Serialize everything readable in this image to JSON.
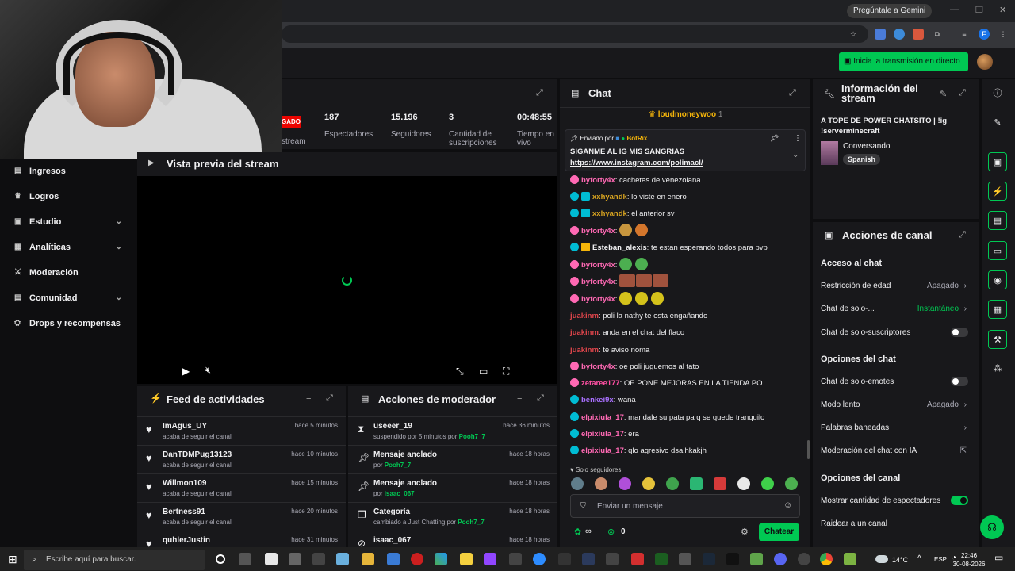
{
  "browser": {
    "gemini": "Pregúntale a Gemini"
  },
  "topnav": {
    "go_live": "Inicia la transmisión en directo"
  },
  "sidebar": {
    "items": [
      {
        "label": "Ingresos",
        "icon": "money-icon"
      },
      {
        "label": "Logros",
        "icon": "trophy-icon"
      },
      {
        "label": "Estudio",
        "icon": "studio-icon"
      },
      {
        "label": "Analíticas",
        "icon": "analytics-icon"
      },
      {
        "label": "Moderación",
        "icon": "sword-icon"
      },
      {
        "label": "Comunidad",
        "icon": "community-icon"
      },
      {
        "label": "Drops y recompensas",
        "icon": "gift-icon"
      }
    ]
  },
  "stats": {
    "live": "GADO",
    "stream_label": "stream",
    "viewers": "187",
    "viewers_label": "Espectadores",
    "followers": "15.196",
    "followers_label": "Seguidores",
    "subs": "3",
    "subs_label": "Cantidad de suscripciones",
    "time": "00:48:55",
    "time_label": "Tiempo en vivo"
  },
  "preview": {
    "title": "Vista previa del stream"
  },
  "feed": {
    "title": "Feed de actividades",
    "items": [
      {
        "name": "ImAgus_UY",
        "desc": "acaba de seguir el canal",
        "time": "hace 5 minutos"
      },
      {
        "name": "DanTDMPug13123",
        "desc": "acaba de seguir el canal",
        "time": "hace 10 minutos"
      },
      {
        "name": "Willmon109",
        "desc": "acaba de seguir el canal",
        "time": "hace 15 minutos"
      },
      {
        "name": "Bertness91",
        "desc": "acaba de seguir el canal",
        "time": "hace 20 minutos"
      },
      {
        "name": "quhlerJustin",
        "desc": "",
        "time": "hace 31 minutos"
      }
    ]
  },
  "modactions": {
    "title": "Acciones de moderador",
    "items": [
      {
        "name": "useeer_19",
        "desc": "suspendido por 5 minutos por",
        "who": "Pooh7_7",
        "time": "hace 36 minutos"
      },
      {
        "name": "Mensaje anclado",
        "desc": "por",
        "who": "Pooh7_7",
        "time": "hace 18 horas"
      },
      {
        "name": "Mensaje anclado",
        "desc": "por",
        "who": "isaac_067",
        "time": "hace 18 horas"
      },
      {
        "name": "Categoría",
        "desc": "cambiado a Just Chatting por",
        "who": "Pooh7_7",
        "time": "hace 18 horas"
      },
      {
        "name": "isaac_067",
        "desc": "",
        "who": "",
        "time": "hace 18 horas"
      }
    ]
  },
  "chat": {
    "title": "Chat",
    "top_user": "loudmoneywoo",
    "top_count": "1",
    "pinned": {
      "sent_by": "Enviado por",
      "bot": "BotRix",
      "text": "SIGANME AL IG MIS SANGRIAS",
      "link": "https://www.instagram.com/polimacl/"
    },
    "messages": [
      {
        "user": "byforty4x",
        "color": "#ff69b4",
        "text": "cachetes de venezolana"
      },
      {
        "user": "xxhyandk",
        "color": "#daa520",
        "text": "lo viste en enero"
      },
      {
        "user": "xxhyandk",
        "color": "#daa520",
        "text": "el anterior sv"
      },
      {
        "user": "byforty4x",
        "color": "#ff69b4",
        "text": ""
      },
      {
        "user": "Esteban_alexis",
        "color": "#efeff1",
        "text": "te estan esperando todos para pvp"
      },
      {
        "user": "byforty4x",
        "color": "#ff69b4",
        "text": ""
      },
      {
        "user": "byforty4x",
        "color": "#ff69b4",
        "text": ""
      },
      {
        "user": "byforty4x",
        "color": "#ff69b4",
        "text": ""
      },
      {
        "user": "juakinm",
        "color": "#e0454b",
        "text": "poli la nathy te esta engañando"
      },
      {
        "user": "juakinm",
        "color": "#e0454b",
        "text": "anda en el chat del flaco"
      },
      {
        "user": "juakinm",
        "color": "#e0454b",
        "text": "te aviso noma"
      },
      {
        "user": "byforty4x",
        "color": "#ff69b4",
        "text": "oe poli juguemos al tato"
      },
      {
        "user": "zetaree177",
        "color": "#ff4fa3",
        "text": "OE PONE MEJORAS EN LA TIENDA PO"
      },
      {
        "user": "benkei9x",
        "color": "#a970ff",
        "text": "wana"
      },
      {
        "user": "elpixiula_17",
        "color": "#ff69b4",
        "text": "mandale su pata pa q se quede tranquilo"
      },
      {
        "user": "elpixiula_17",
        "color": "#ff69b4",
        "text": "era"
      },
      {
        "user": "elpixiula_17",
        "color": "#ff69b4",
        "text": "qlo agresivo dsajhkakjh"
      }
    ],
    "followers_only": "Solo seguidores",
    "placeholder": "Enviar un mensaje",
    "points": "∞",
    "points2": "0",
    "send": "Chatear"
  },
  "info": {
    "title": "Información del stream",
    "stream_title": "A TOPE DE POWER CHATSITO | !ig !serverminecraft",
    "category": "Conversando",
    "tag": "Spanish"
  },
  "actions": {
    "title": "Acciones de canal",
    "chat_access": "Acceso al chat",
    "age": "Restricción de edad",
    "age_val": "Apagado",
    "solo": "Chat de solo-...",
    "solo_val": "Instantáneo",
    "subs_only": "Chat de solo-suscriptores",
    "chat_options": "Opciones del chat",
    "emotes": "Chat de solo-emotes",
    "slow": "Modo lento",
    "slow_val": "Apagado",
    "banned": "Palabras baneadas",
    "ai": "Moderación del chat con IA",
    "channel_options": "Opciones del canal",
    "show_viewers": "Mostrar cantidad de espectadores",
    "raid": "Raidear a un canal"
  },
  "taskbar": {
    "search": "Escribe aquí para buscar.",
    "temp": "14°C",
    "lang": "ESP",
    "time": "22:46",
    "date": "30-08-2026"
  },
  "colors": {
    "accent": "#00c853",
    "bg": "#0e0e10",
    "panel": "#18181b"
  }
}
